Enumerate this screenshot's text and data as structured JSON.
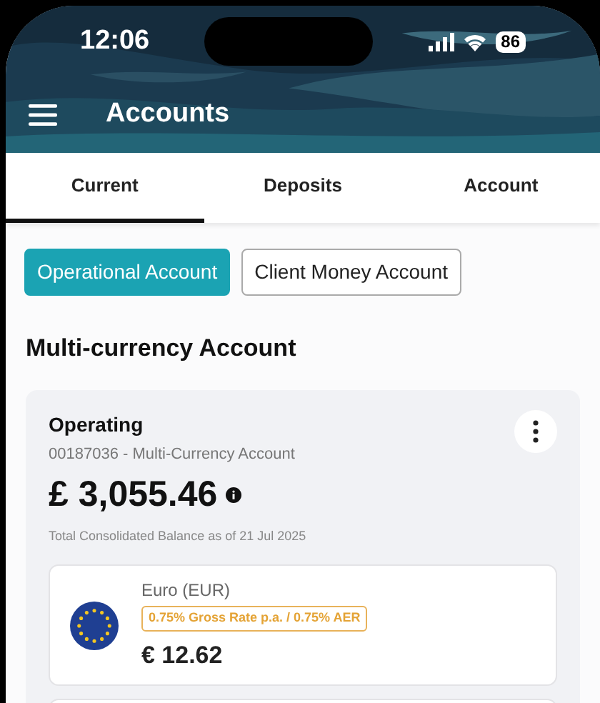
{
  "status_bar": {
    "time": "12:06",
    "battery": "86"
  },
  "header": {
    "title": "Accounts"
  },
  "tabs": [
    {
      "label": "Current",
      "selected": true
    },
    {
      "label": "Deposits",
      "selected": false
    },
    {
      "label": "Account",
      "selected": false
    }
  ],
  "account_types": [
    {
      "label": "Operational Account",
      "selected": true
    },
    {
      "label": "Client Money Account",
      "selected": false
    }
  ],
  "section_title": "Multi-currency Account",
  "account_card": {
    "name": "Operating",
    "number": "00187036 - Multi-Currency Account",
    "balance": "£ 3,055.46",
    "balance_note": "Total Consolidated Balance as of 21 Jul 2025",
    "currencies": [
      {
        "name": "Euro (EUR)",
        "rate": "0.75% Gross Rate p.a. / 0.75% AER",
        "balance": "€ 12.62"
      }
    ]
  }
}
